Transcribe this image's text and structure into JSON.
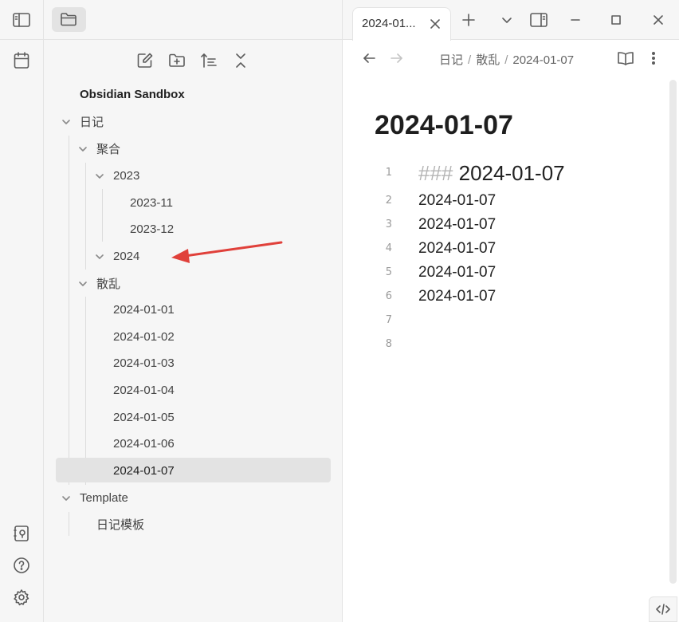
{
  "sidebar": {
    "vault_name": "Obsidian Sandbox",
    "toolbar_icons": [
      "new-note-icon",
      "new-folder-icon",
      "sort-icon",
      "collapse-all-icon"
    ],
    "tree": [
      {
        "label": "日记"
      },
      {
        "label": "聚合"
      },
      {
        "label": "2023"
      },
      {
        "label": "2023-11"
      },
      {
        "label": "2023-12"
      },
      {
        "label": "2024"
      },
      {
        "label": "散乱"
      },
      {
        "label": "2024-01-01"
      },
      {
        "label": "2024-01-02"
      },
      {
        "label": "2024-01-03"
      },
      {
        "label": "2024-01-04"
      },
      {
        "label": "2024-01-05"
      },
      {
        "label": "2024-01-06"
      },
      {
        "label": "2024-01-07"
      },
      {
        "label": "Template"
      },
      {
        "label": "日记模板"
      }
    ]
  },
  "tab": {
    "title": "2024-01..."
  },
  "breadcrumb": {
    "part1": "日记",
    "part2": "散乱",
    "part3": "2024-01-07",
    "sep": "/"
  },
  "note": {
    "title": "2024-01-07",
    "lines": [
      {
        "no": "1",
        "hash": "###",
        "text": "2024-01-07"
      },
      {
        "no": "2",
        "text": "2024-01-07"
      },
      {
        "no": "3",
        "text": "2024-01-07"
      },
      {
        "no": "4",
        "text": "2024-01-07"
      },
      {
        "no": "5",
        "text": "2024-01-07"
      },
      {
        "no": "6",
        "text": "2024-01-07"
      },
      {
        "no": "7",
        "text": ""
      },
      {
        "no": "8",
        "text": ""
      }
    ]
  },
  "colors": {
    "accent_arrow": "#e0403a",
    "selected_bg": "#e3e3e3"
  }
}
